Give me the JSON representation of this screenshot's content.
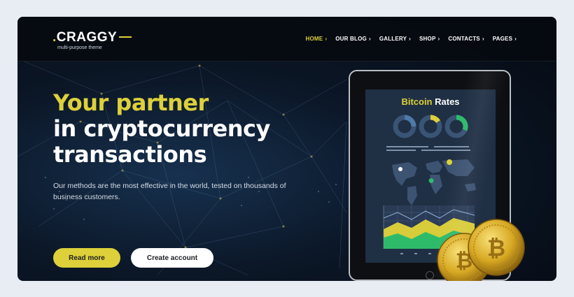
{
  "brand": {
    "name": "CRAGGY",
    "tagline": "multi-purpose theme"
  },
  "nav": [
    {
      "label": "HOME",
      "active": true
    },
    {
      "label": "OUR BLOG",
      "active": false
    },
    {
      "label": "GALLERY",
      "active": false
    },
    {
      "label": "SHOP",
      "active": false
    },
    {
      "label": "CONTACTS",
      "active": false
    },
    {
      "label": "PAGES",
      "active": false
    }
  ],
  "hero": {
    "line1": "Your partner",
    "line2": "in cryptocurrency",
    "line3": "transactions",
    "description": "Our methods are the most effective in the world, tested on thousands of business customers.",
    "read_more": "Read more",
    "create_account": "Create account"
  },
  "tablet": {
    "title_word1": "Bitcoin",
    "title_word2": "Rates"
  },
  "colors": {
    "accent": "#ddd03a",
    "green": "#2dbb6a",
    "dark": "#050a12"
  },
  "icons": [
    "chevron-right-icon",
    "bitcoin-coin-icon",
    "map-pin-icon"
  ]
}
